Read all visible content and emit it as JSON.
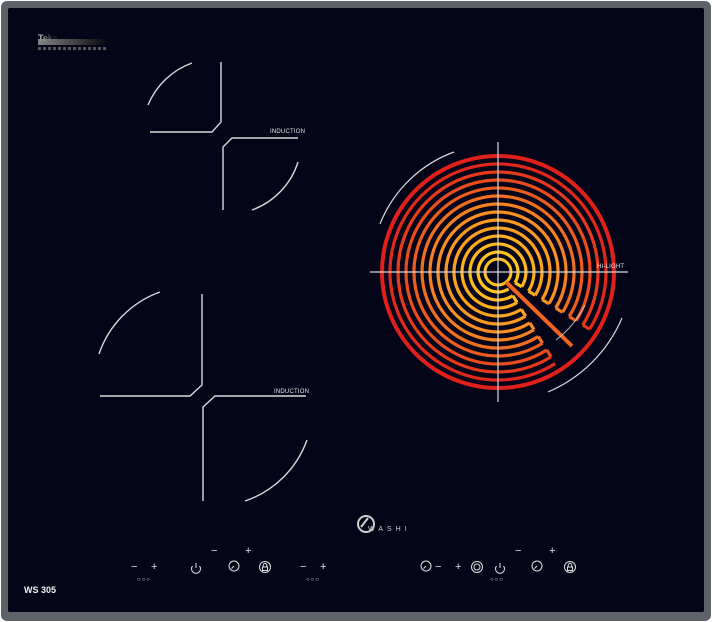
{
  "brand_top": {
    "text": "Teka"
  },
  "zones": {
    "top_left": {
      "label": "INDUCTION"
    },
    "bottom_left": {
      "label": "INDUCTION"
    },
    "right": {
      "label": "HI-LIGHT"
    }
  },
  "logo": {
    "name": "WASHI",
    "icon": "washi-logo-icon"
  },
  "model": "WS 305",
  "controls": {
    "minus": "−",
    "plus": "+",
    "power_icon": "power-icon",
    "timer_icon": "timer-icon",
    "lock_icon": "lock-icon",
    "zone_dots": "○○○"
  },
  "colors": {
    "glass": "#05051a",
    "frame": "#5e6269",
    "coil_outer": "#e0201a",
    "coil_mid": "#f07a20",
    "coil_inner": "#ffb820",
    "marks": "#d9d9d9"
  }
}
